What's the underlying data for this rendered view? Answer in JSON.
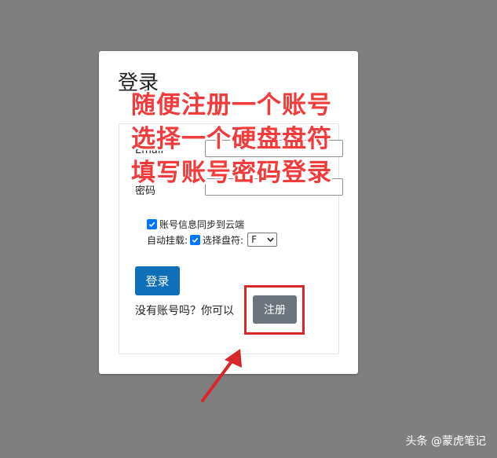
{
  "card": {
    "title": "登录",
    "email_label": "Email",
    "email_value": "",
    "password_label": "密码",
    "password_value": "",
    "sync_label": "账号信息同步到云端",
    "automount_label": "自动挂载:",
    "select_drive_label": "选择盘符:",
    "drive_value": "F",
    "login_button": "登录",
    "no_account_text": "没有账号吗？你可以",
    "register_button": "注册"
  },
  "annotations": {
    "line1": "随便注册一个账号",
    "line2": "选择一个硬盘盘符",
    "line3": "填写账号密码登录",
    "highlight_color": "#d9262a",
    "text_color": "#f23c3c"
  },
  "watermark": "头条 @蒙虎笔记",
  "checkboxes": {
    "sync_checked": true,
    "select_drive_checked": true
  },
  "colors": {
    "background": "#7f7f7f",
    "login_button": "#0e6eb8",
    "register_button": "#6c757d",
    "checkbox": "#0075ff"
  }
}
